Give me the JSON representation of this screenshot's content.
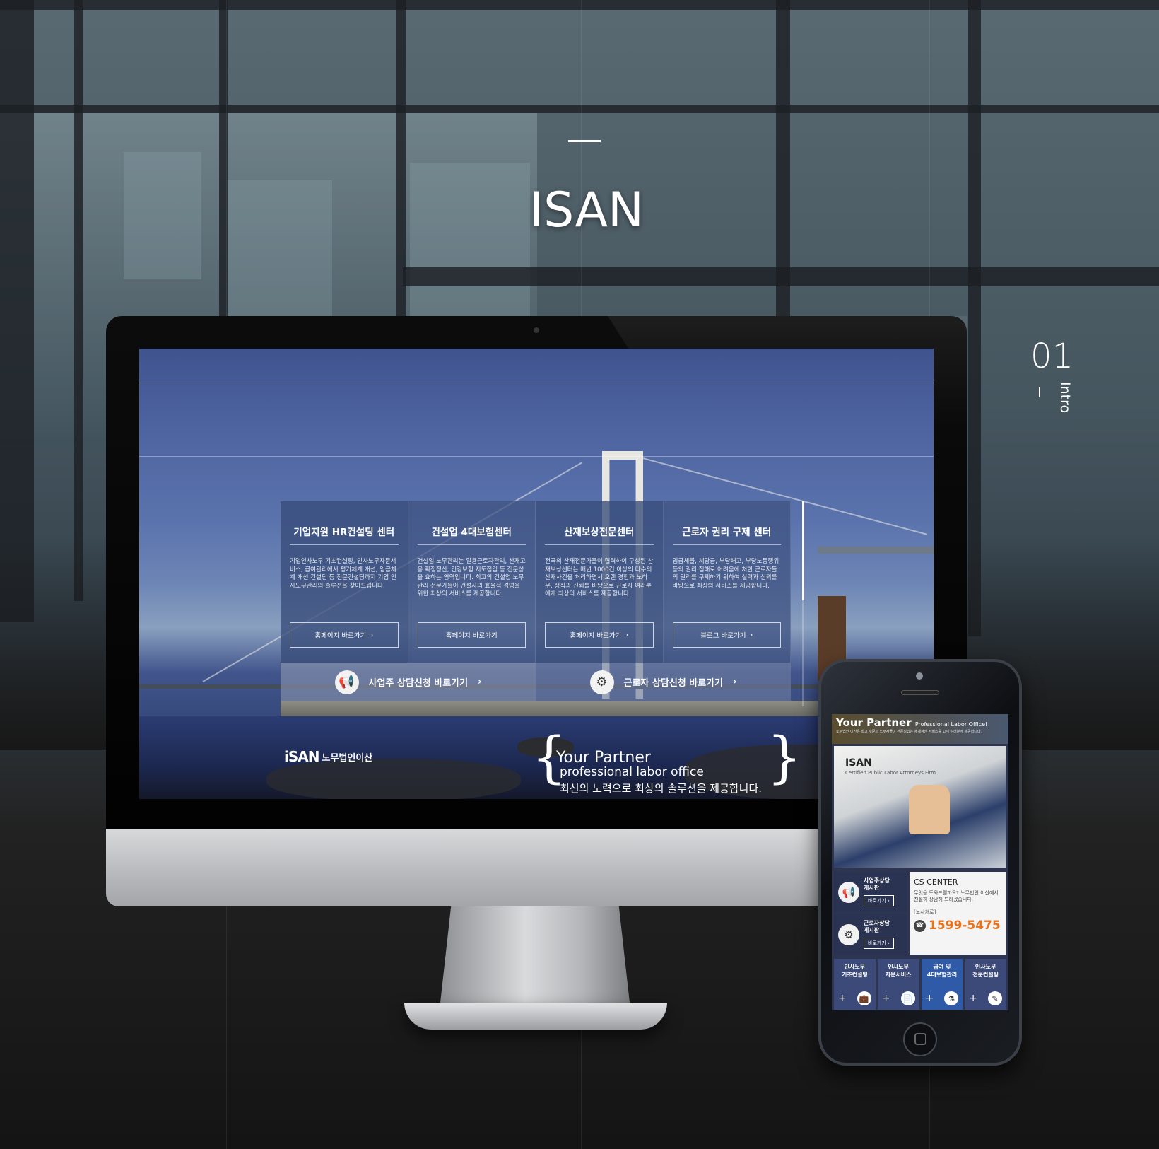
{
  "header": {
    "title": "ISAN"
  },
  "section": {
    "number": "01",
    "label": "Intro"
  },
  "site": {
    "logo_mark": "iSAN",
    "logo_name": "노무법인이산",
    "tagline_1": "Your Partner",
    "tagline_2": "professional labor office",
    "tagline_3": "최선의 노력으로 최상의 솔루션을 제공합니다.",
    "centers": [
      {
        "title": "기업지원 HR컨설팅 센터",
        "desc": "기업인사노무 기초컨설팅, 인사노무자문서비스, 급여관리에서 평가체계 개선, 임금체계 개선 컨설팅 등 전문컨설팅까지 기업 인사노무관리의 솔루션을 찾아드립니다.",
        "button": "홈페이지 바로가기"
      },
      {
        "title": "건설업 4대보험센터",
        "desc": "건설업 노무관리는 일용근로자관리, 산재고용 확정정산, 건강보험 지도점검 등 전문성을 요하는 영역입니다. 최고의 건설업 노무관리 전문가들이 건설사의 효율적 경영을 위한 최상의 서비스를 제공합니다.",
        "button": "홈페이지 바로가기"
      },
      {
        "title": "산재보상전문센터",
        "desc": "전국의 산재전문가들이 협력하여 구성된 산재보상센터는 매년 1000건 이상의 다수의 산재사건을 처리하면서 오랜 경험과 노하우, 정직과 신뢰를 바탕으로 근로자 여러분에게 최상의 서비스를 제공합니다.",
        "button": "홈페이지 바로가기"
      },
      {
        "title": "근로자 권리 구제 센터",
        "desc": "임금체불, 체당금, 부당해고, 부당노동행위 등의 권리 침해로 어려움에 처한 근로자들의 권리를 구제하기 위하여 실력과 신뢰를 바탕으로 최상의 서비스를 제공합니다.",
        "button": "블로그 바로가기"
      }
    ],
    "employer_consult": "사업주 상담신청 바로가기",
    "worker_consult": "근로자 상담신청 바로가기",
    "chevron": "›"
  },
  "mobile": {
    "your_partner": "Your Partner",
    "pro_office": "Professional Labor Office!",
    "subtitle": "노무법인 이산은 최고 수준의 노무사들이 전문성있는 체계적인 서비스를 고객 여러분께 제공합니다.",
    "hero_title": "ISAN",
    "hero_sub": "Certified Public Labor Attorneys Firm",
    "board_1_l1": "사업주상담",
    "board_1_l2": "게시판",
    "board_2_l1": "근로자상담",
    "board_2_l2": "게시판",
    "go_label": "바로가기 ›",
    "cs_title": "CS CENTER",
    "cs_desc": "무엇을 도와드릴까요? 노무법인 이산에서 친절히 상담해 드리겠습니다.",
    "cs_label": "[노사처로]",
    "phone": "1599-5475",
    "services": [
      {
        "l1": "인사노무",
        "l2": "기초컨설팅"
      },
      {
        "l1": "인사노무",
        "l2": "자문서비스"
      },
      {
        "l1": "급여 및",
        "l2": "4대보험관리"
      },
      {
        "l1": "인사노무",
        "l2": "전문컨설팅"
      }
    ],
    "plus": "+"
  },
  "icons": [
    "megaphone-icon",
    "gear-icon",
    "phone-icon",
    "briefcase-icon",
    "document-icon",
    "flask-icon",
    "edit-icon"
  ]
}
